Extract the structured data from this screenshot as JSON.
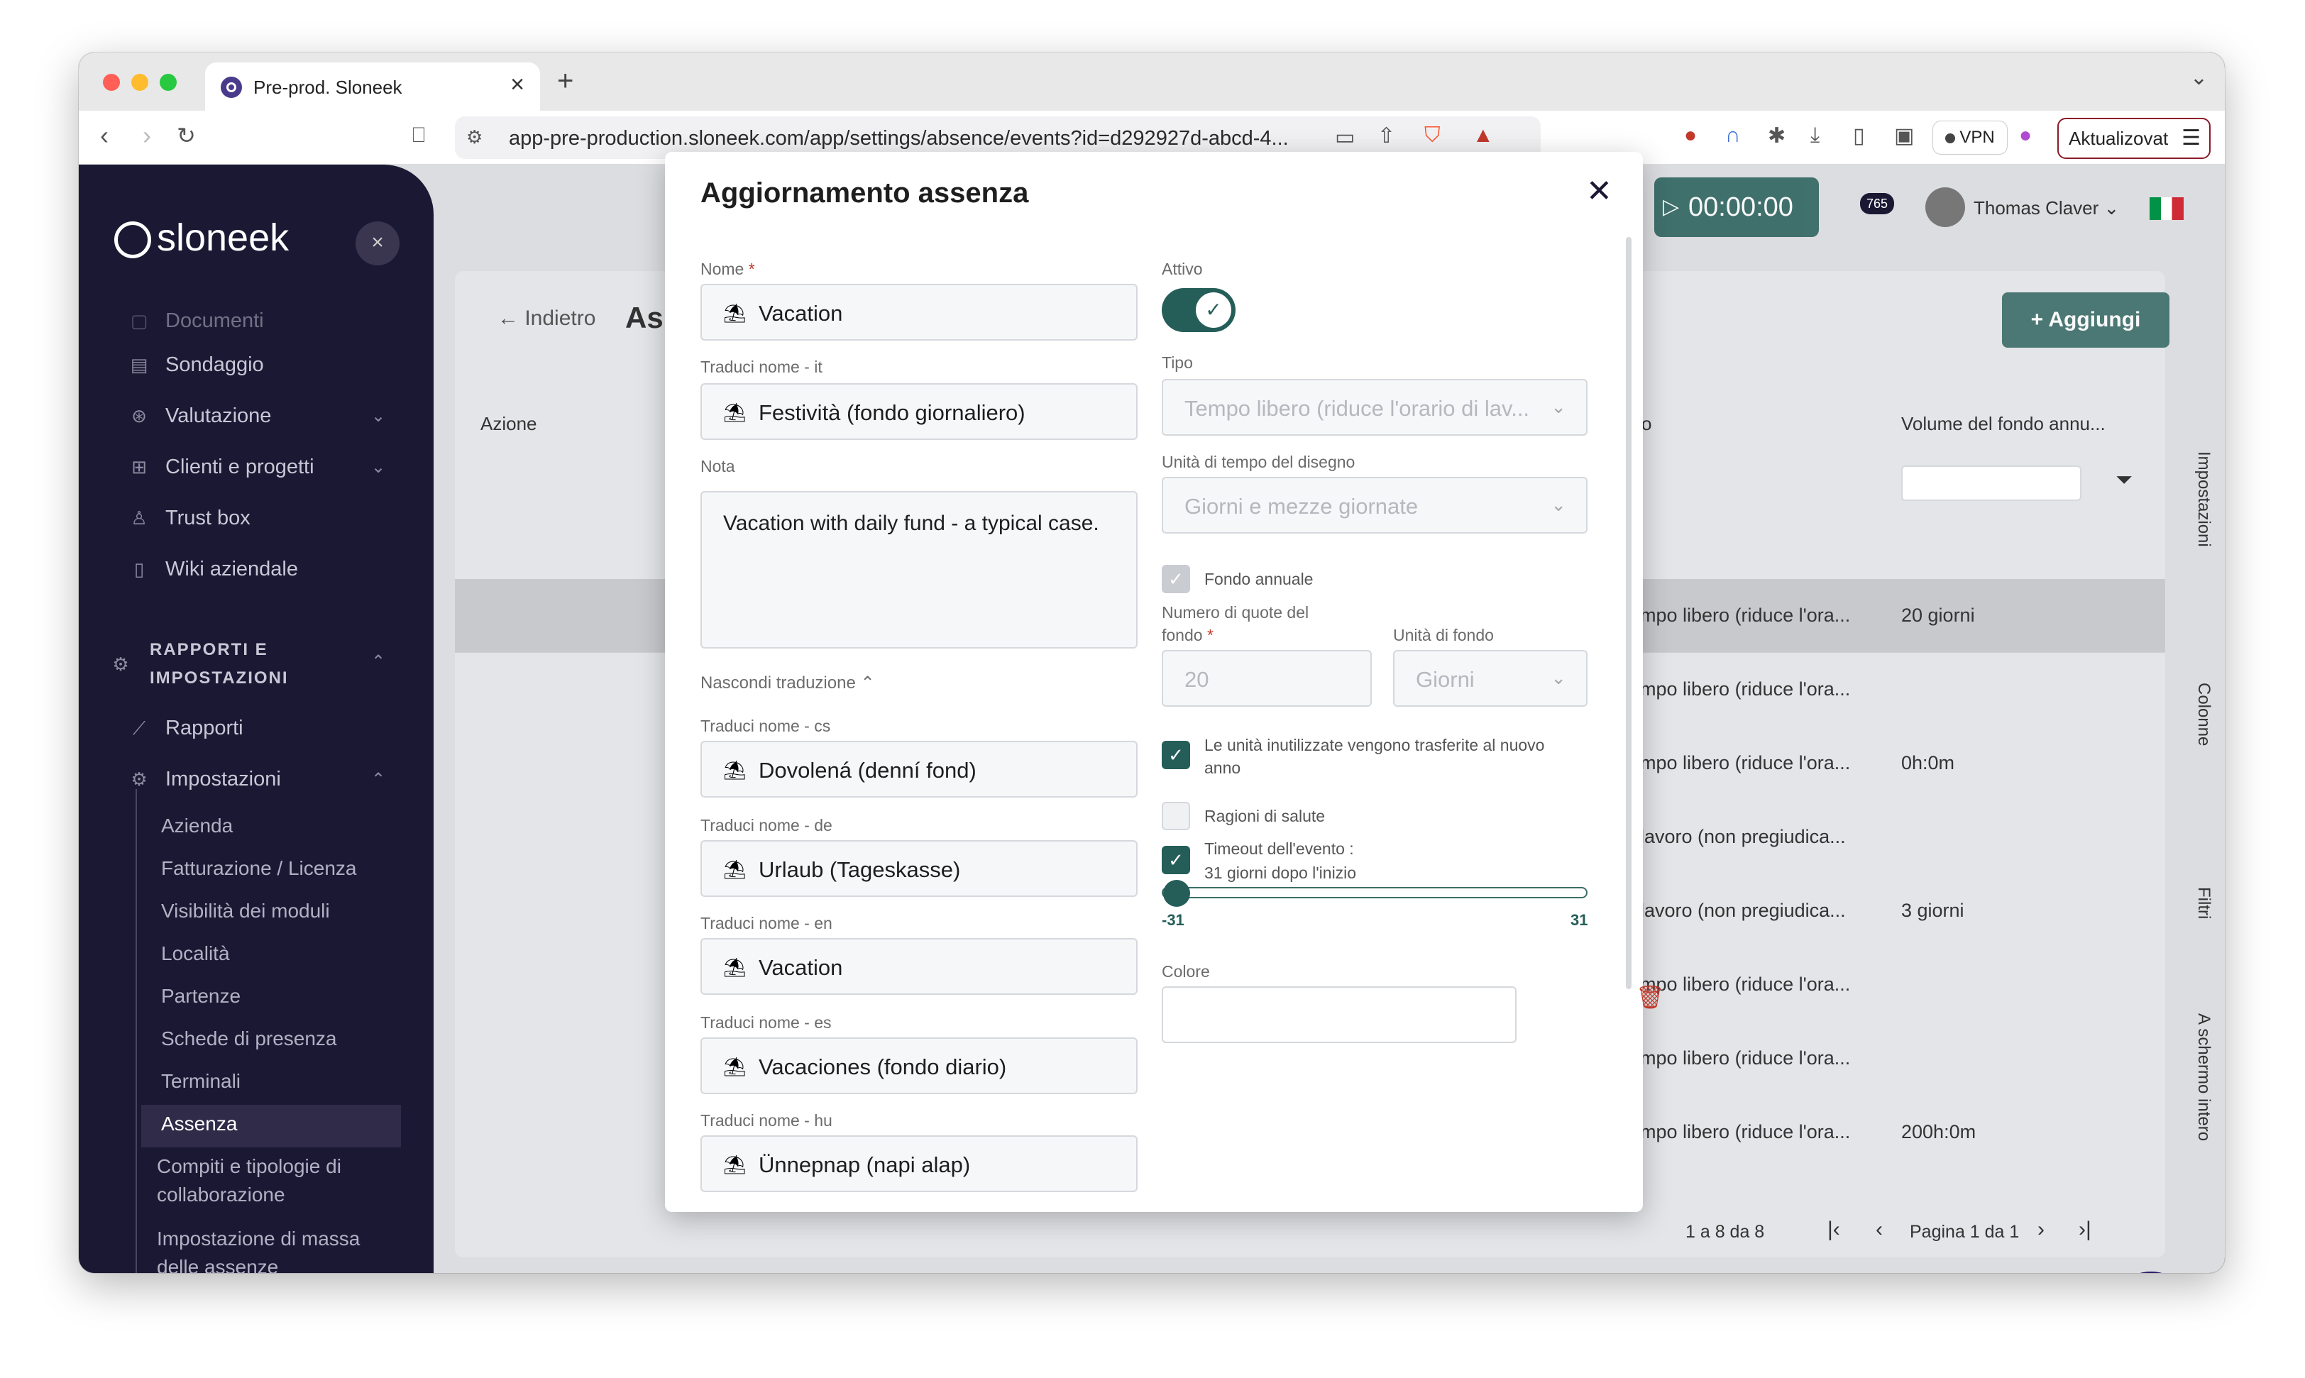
{
  "browser": {
    "tab_title": "Pre-prod. Sloneek",
    "url": "app-pre-production.sloneek.com/app/settings/absence/events?id=d292927d-abcd-4...",
    "vpn_label": "VPN",
    "update_label": "Aktualizovat"
  },
  "sidebar": {
    "logo": "sloneek",
    "items": [
      {
        "label": "Documenti",
        "icon": "document-icon"
      },
      {
        "label": "Sondaggio",
        "icon": "survey-icon"
      },
      {
        "label": "Valutazione",
        "icon": "evaluation-icon"
      },
      {
        "label": "Clienti e progetti",
        "icon": "clients-icon"
      },
      {
        "label": "Trust box",
        "icon": "trust-box-icon"
      },
      {
        "label": "Wiki aziendale",
        "icon": "wiki-icon"
      }
    ],
    "section_title": "RAPPORTI E IMPOSTAZIONI",
    "reports_label": "Rapporti",
    "settings_label": "Impostazioni",
    "settings_items": [
      "Azienda",
      "Fatturazione / Licenza",
      "Visibilità dei moduli",
      "Località",
      "Partenze",
      "Schede di presenza",
      "Terminali",
      "Assenza",
      "Compiti e tipologie di collaborazione",
      "Impostazione di massa delle assenze"
    ]
  },
  "header": {
    "timer": "00:00:00",
    "notifications_count": "765",
    "user_name": "Thomas Claver"
  },
  "page": {
    "back_label": "Indietro",
    "title_partial": "As",
    "add_button": "Aggiungi",
    "columns": [
      "Azione",
      "o",
      "Volume del fondo annu..."
    ],
    "rows": [
      {
        "type": "mpo libero (riduce l'ora...",
        "volume": "20 giorni"
      },
      {
        "type": "mpo libero (riduce l'ora...",
        "volume": ""
      },
      {
        "type": "mpo libero (riduce l'ora...",
        "volume": "0h:0m"
      },
      {
        "type": "lavoro (non pregiudica...",
        "volume": ""
      },
      {
        "type": "lavoro (non pregiudica...",
        "volume": "3 giorni"
      },
      {
        "type": "mpo libero (riduce l'ora...",
        "volume": ""
      },
      {
        "type": "mpo libero (riduce l'ora...",
        "volume": ""
      },
      {
        "type": "mpo libero (riduce l'ora...",
        "volume": "200h:0m"
      }
    ],
    "side_tabs": [
      "Impostazioni",
      "Colonne",
      "Filtri",
      "A schermo intero"
    ],
    "pager_range": "1 a 8 da 8",
    "pager_page": "Pagina 1 da 1"
  },
  "modal": {
    "title": "Aggiornamento assenza",
    "name_label": "Nome",
    "name_value": "Vacation",
    "translate_it_label": "Traduci nome - it",
    "translate_it_value": "Festività (fondo giornaliero)",
    "note_label": "Nota",
    "note_value": "Vacation with daily fund - a typical case.",
    "hide_translation": "Nascondi traduzione",
    "translations": [
      {
        "label": "Traduci nome - cs",
        "value": "Dovolená (denní fond)"
      },
      {
        "label": "Traduci nome - de",
        "value": "Urlaub (Tageskasse)"
      },
      {
        "label": "Traduci nome - en",
        "value": "Vacation"
      },
      {
        "label": "Traduci nome - es",
        "value": "Vacaciones (fondo diario)"
      },
      {
        "label": "Traduci nome - hu",
        "value": "Ünnepnap (napi alap)"
      }
    ],
    "active_label": "Attivo",
    "type_label": "Tipo",
    "type_value": "Tempo libero (riduce l'orario di lav...",
    "time_unit_label": "Unità di tempo del disegno",
    "time_unit_value": "Giorni e mezze giornate",
    "annual_fund_label": "Fondo annuale",
    "quota_label_1": "Numero di quote del",
    "quota_label_2": "fondo",
    "quota_value": "20",
    "fund_unit_label": "Unità di fondo",
    "fund_unit_value": "Giorni",
    "unused_transfer_1": "Le unità inutilizzate vengono trasferite al nuovo",
    "unused_transfer_2": "anno",
    "health_reasons": "Ragioni di salute",
    "timeout_1": "Timeout dell'evento :",
    "timeout_2": "31 giorni dopo l'inizio",
    "slider_min": "-31",
    "slider_max": "31",
    "slider_value": -31,
    "color_label": "Colore"
  }
}
